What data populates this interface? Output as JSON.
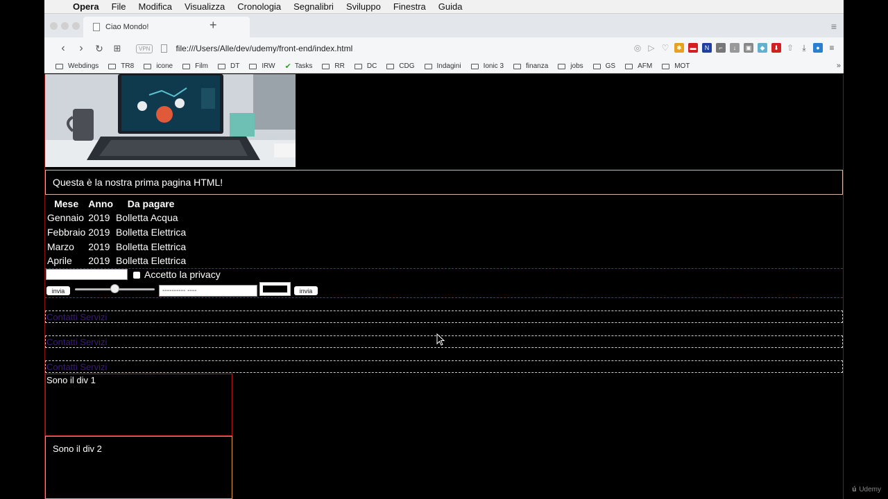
{
  "menubar": {
    "app": "Opera",
    "items": [
      "File",
      "Modifica",
      "Visualizza",
      "Cronologia",
      "Segnalibri",
      "Sviluppo",
      "Finestra",
      "Guida"
    ]
  },
  "tab": {
    "title": "Ciao Mondo!"
  },
  "toolbar": {
    "vpn_label": "VPN",
    "url": "file:///Users/Alle/dev/udemy/front-end/index.html"
  },
  "bookmarks": [
    "Webdings",
    "TR8",
    "icone",
    "Film",
    "DT",
    "IRW",
    "Tasks",
    "RR",
    "DC",
    "CDG",
    "Indagini",
    "Ionic 3",
    "finanza",
    "jobs",
    "GS",
    "AFM",
    "MOT"
  ],
  "page": {
    "intro": "Questa è la nostra prima pagina HTML!",
    "table": {
      "headers": [
        "Mese",
        "Anno",
        "Da pagare"
      ],
      "rows": [
        [
          "Gennaio",
          "2019",
          "Bolletta Acqua"
        ],
        [
          "Febbraio",
          "2019",
          "Bolletta Elettrica"
        ],
        [
          "Marzo",
          "2019",
          "Bolletta Elettrica"
        ],
        [
          "Aprile",
          "2019",
          "Bolletta Elettrica"
        ]
      ]
    },
    "form": {
      "privacy_label": "Accetto la privacy",
      "submit_label": "invia",
      "range_value": 0.5,
      "date_placeholder": "---------- ----",
      "color_value": "#000000"
    },
    "nav_links": [
      "Contatti Servizi",
      "Contatti Servizi",
      "Contatti Servizi"
    ],
    "div1_text": "Sono il div 1",
    "div2_text": "Sono il div 2"
  },
  "watermark": "Udemy",
  "colors": {
    "page_bg": "#000000",
    "link": "#3a1a7a",
    "border_red": "#b01818",
    "border_orange": "#e8a040"
  }
}
